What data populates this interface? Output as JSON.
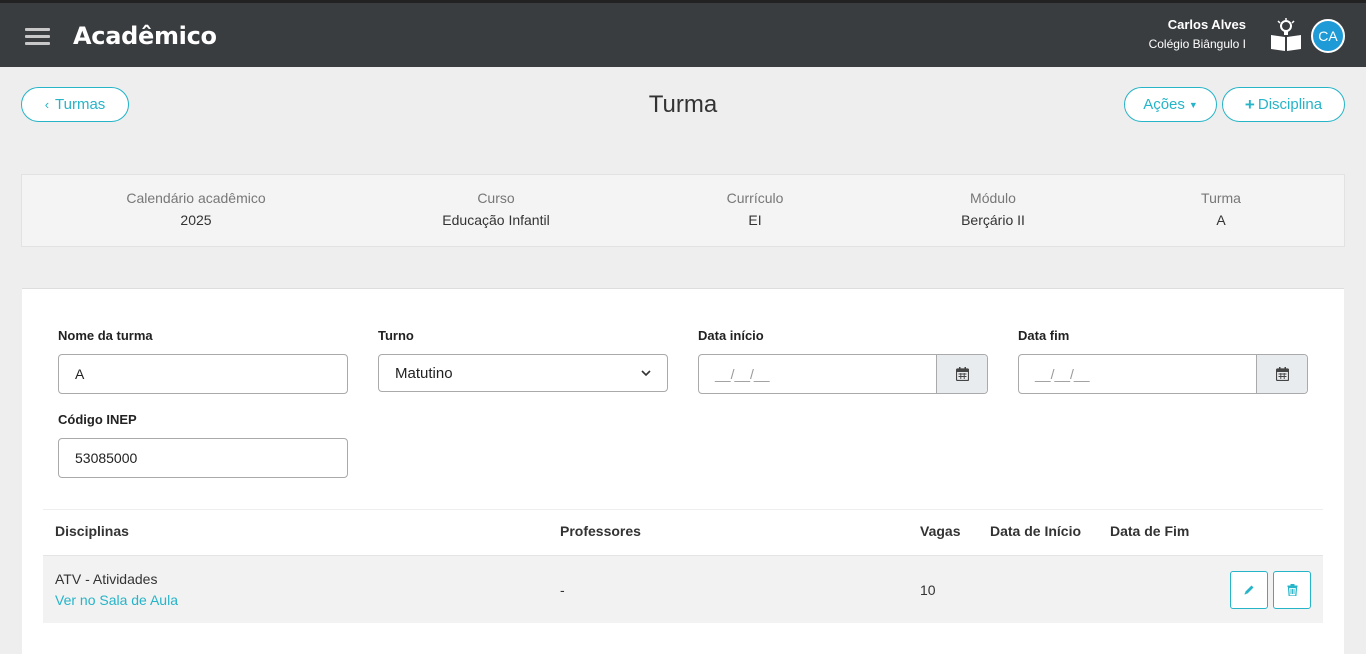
{
  "header": {
    "app_title": "Acadêmico",
    "user_name": "Carlos Alves",
    "school_name": "Colégio Biângulo I",
    "avatar_initials": "CA"
  },
  "toolbar": {
    "back_label": "Turmas",
    "page_title": "Turma",
    "acoes_label": "Ações",
    "disciplina_label": "Disciplina"
  },
  "info": [
    {
      "label": "Calendário acadêmico",
      "value": "2025"
    },
    {
      "label": "Curso",
      "value": "Educação Infantil"
    },
    {
      "label": "Currículo",
      "value": "EI"
    },
    {
      "label": "Módulo",
      "value": "Berçário II"
    },
    {
      "label": "Turma",
      "value": "A"
    }
  ],
  "form": {
    "nome_label": "Nome da turma",
    "nome_value": "A",
    "turno_label": "Turno",
    "turno_value": "Matutino",
    "data_inicio_label": "Data início",
    "data_inicio_placeholder": "__/__/__",
    "data_fim_label": "Data fim",
    "data_fim_placeholder": "__/__/__",
    "inep_label": "Código INEP",
    "inep_value": "53085000"
  },
  "table": {
    "headers": [
      "Disciplinas",
      "Professores",
      "Vagas",
      "Data de Início",
      "Data de Fim"
    ],
    "rows": [
      {
        "disciplina": "ATV - Atividades",
        "link": "Ver no Sala de Aula",
        "professores": "-",
        "vagas": "10",
        "data_inicio": "",
        "data_fim": ""
      }
    ]
  },
  "colors": {
    "accent": "#26b4c8",
    "topbar": "#3a3d40",
    "avatar": "#1e9ad6"
  }
}
